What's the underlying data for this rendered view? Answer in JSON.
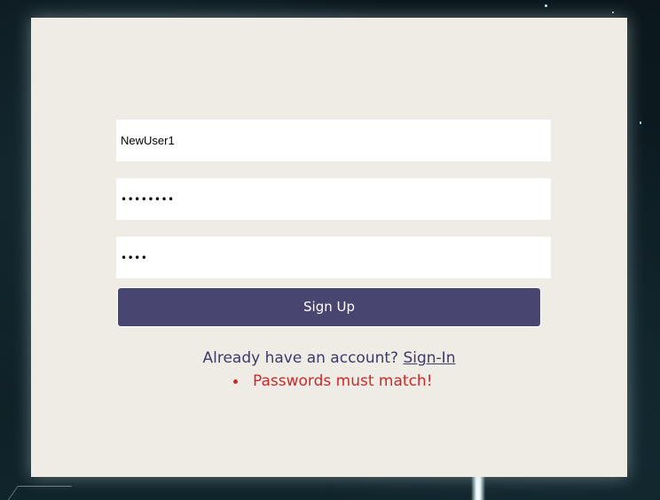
{
  "form": {
    "username_value": "NewUser1",
    "password_value": "password",
    "confirm_value": "pass",
    "submit_label": "Sign Up"
  },
  "footer": {
    "prompt": "Already have an account?",
    "signin_link": "Sign-In"
  },
  "errors": [
    "Passwords must match!"
  ],
  "colors": {
    "panel": "#efebe5",
    "button": "#484570",
    "link": "#3f3a6a",
    "error": "#cc2a2a"
  }
}
